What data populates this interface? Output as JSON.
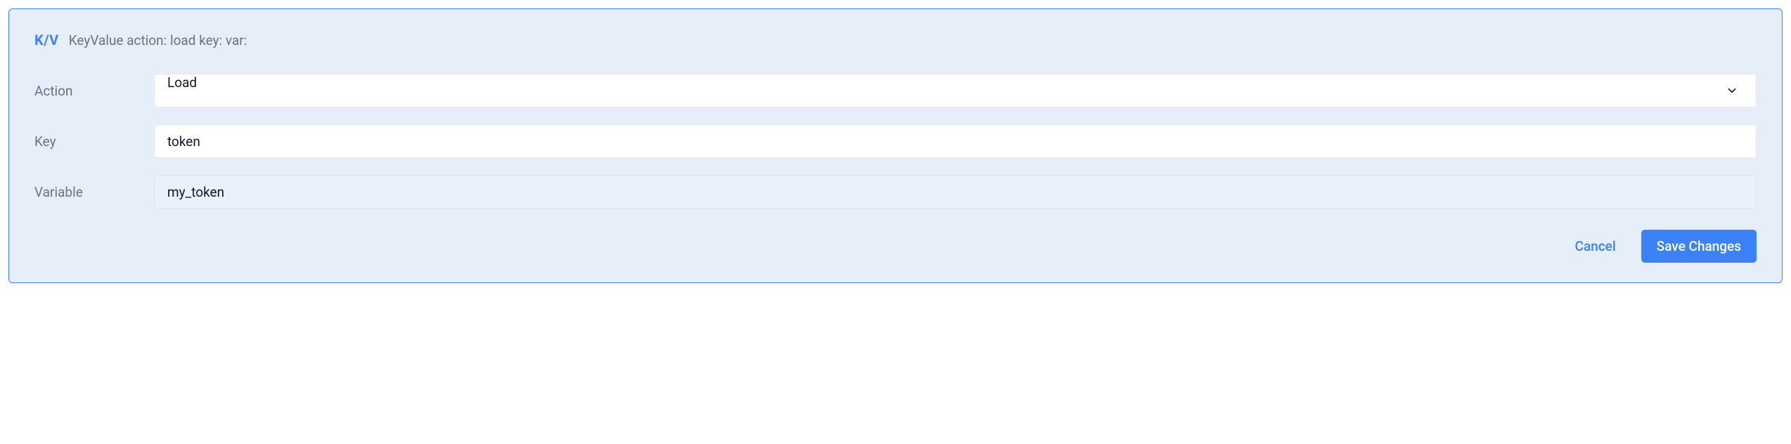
{
  "header": {
    "badge": "K/V",
    "description": "KeyValue action: load key: var:"
  },
  "form": {
    "action": {
      "label": "Action",
      "value": "Load"
    },
    "key": {
      "label": "Key",
      "value": "token"
    },
    "variable": {
      "label": "Variable",
      "value": "my_token"
    }
  },
  "footer": {
    "cancel": "Cancel",
    "save": "Save Changes"
  }
}
